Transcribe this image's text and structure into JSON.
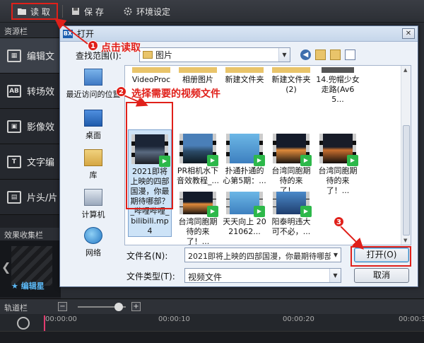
{
  "toolbar": {
    "read_label": "读 取",
    "save_label": "保 存",
    "env_label": "环境设定"
  },
  "sidebar": {
    "header": "资源栏",
    "items": [
      {
        "label": "编辑文",
        "icon": "film-icon"
      },
      {
        "label": "转场效",
        "icon": "transition-icon"
      },
      {
        "label": "影像效",
        "icon": "effect-icon"
      },
      {
        "label": "文字编",
        "icon": "text-icon"
      },
      {
        "label": "片头/片",
        "icon": "title-icon"
      }
    ],
    "fx_header": "效果收集栏",
    "fx_label": "编辑星"
  },
  "trackbar": {
    "label": "轨道栏",
    "zoom_out": "−",
    "zoom_in": "+",
    "zoom_level": 0.85
  },
  "timeline": {
    "ticks": [
      "00:00:00",
      "00:00:10",
      "00:00:20",
      "00:00:30"
    ]
  },
  "dialog": {
    "title": "打开",
    "lookin_label": "查找范围(I):",
    "lookin_value": "图片",
    "places": [
      {
        "label": "最近访问的位置",
        "icon": "recent-icon"
      },
      {
        "label": "桌面",
        "icon": "desktop-icon"
      },
      {
        "label": "库",
        "icon": "library-icon"
      },
      {
        "label": "计算机",
        "icon": "computer-icon"
      },
      {
        "label": "网络",
        "icon": "network-icon"
      }
    ],
    "files": [
      {
        "caption": "VideoProc",
        "kind": "folder"
      },
      {
        "caption": "相册图片",
        "kind": "folder"
      },
      {
        "caption": "新建文件夹",
        "kind": "folder"
      },
      {
        "caption": "新建文件夹 (2)",
        "kind": "folder"
      },
      {
        "caption": "14.兜帽少女走路(Av65...",
        "kind": "video"
      },
      {
        "caption": "2021即将上映的四部国漫，你最期待哪部？_哔哩哔哩_bilibili.mp4",
        "kind": "video",
        "selected": true
      },
      {
        "caption": "PR相机水下音效教程_...",
        "kind": "video"
      },
      {
        "caption": "扑通扑通的心第5期：...",
        "kind": "video"
      },
      {
        "caption": "台湾同胞期待的来了！...",
        "kind": "video"
      },
      {
        "caption": "台湾同胞期待的来了！...",
        "kind": "video"
      },
      {
        "caption": "台湾同胞期待的来了！...",
        "kind": "video"
      },
      {
        "caption": "天天向上 2021062...",
        "kind": "video"
      },
      {
        "caption": "阳泰明违大可不必，...",
        "kind": "video"
      }
    ],
    "filename_label": "文件名(N):",
    "filename_value": "2021即将上映的四部国漫，你最期待哪部？",
    "filetype_label": "文件类型(T):",
    "filetype_value": "视频文件",
    "open_label": "打开(O)",
    "cancel_label": "取消"
  },
  "annotations": {
    "step1_num": "1",
    "step1_text": "点击读取",
    "step2_num": "2",
    "step2_text": "选择需要的视频文件",
    "step3_num": "3",
    "accent_color": "#e0201a"
  }
}
